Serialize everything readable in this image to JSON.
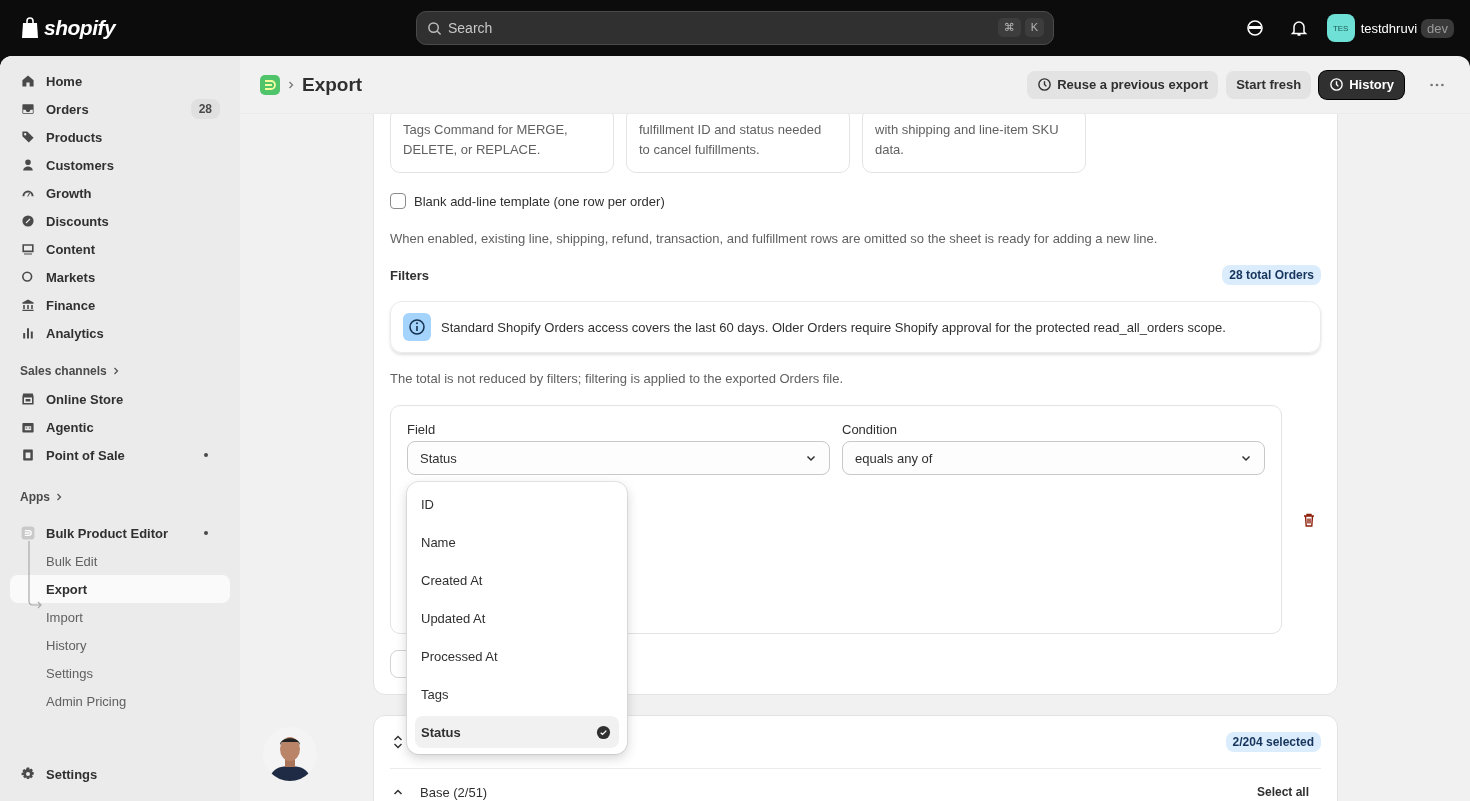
{
  "topbar": {
    "logo": "shopify",
    "search": {
      "placeholder": "Search",
      "keys": [
        "⌘",
        "K"
      ]
    },
    "user": {
      "initials": "TES",
      "name": "testdhruvi",
      "badge": "dev"
    }
  },
  "sidebar": {
    "items": [
      {
        "label": "Home"
      },
      {
        "label": "Orders",
        "count": "28"
      },
      {
        "label": "Products"
      },
      {
        "label": "Customers"
      },
      {
        "label": "Growth"
      },
      {
        "label": "Discounts"
      },
      {
        "label": "Content"
      },
      {
        "label": "Markets"
      },
      {
        "label": "Finance"
      },
      {
        "label": "Analytics"
      }
    ],
    "sales_channels": {
      "heading": "Sales channels",
      "items": [
        {
          "label": "Online Store",
          "dot": false
        },
        {
          "label": "Agentic",
          "dot": false
        },
        {
          "label": "Point of Sale",
          "dot": true
        }
      ]
    },
    "apps": {
      "heading": "Apps",
      "app": {
        "label": "Bulk Product Editor",
        "dot": true
      },
      "children": [
        {
          "label": "Bulk Edit",
          "selected": false
        },
        {
          "label": "Export",
          "selected": true
        },
        {
          "label": "Import",
          "selected": false
        },
        {
          "label": "History",
          "selected": false
        },
        {
          "label": "Settings",
          "selected": false
        },
        {
          "label": "Admin Pricing",
          "selected": false
        }
      ]
    },
    "footer": "Settings"
  },
  "header": {
    "title": "Export",
    "buttons": [
      {
        "label": "Reuse a previous export",
        "clock": true,
        "kind": "secondary"
      },
      {
        "label": "Start fresh",
        "clock": false,
        "kind": "secondary"
      },
      {
        "label": "History",
        "clock": true,
        "kind": "primary"
      }
    ]
  },
  "templates": [
    {
      "lines": [
        "Tags Command for MERGE,",
        "DELETE, or REPLACE."
      ]
    },
    {
      "lines": [
        "fulfillment ID and status needed",
        "to cancel fulfillments."
      ]
    },
    {
      "lines": [
        "with shipping and line-item SKU",
        "data."
      ]
    }
  ],
  "blank_template": {
    "label": "Blank add-line template (one row per order)",
    "checked": false
  },
  "hint": "When enabled, existing line, shipping, refund, transaction, and fulfillment rows are omitted so the sheet is ready for adding a new line.",
  "filters": {
    "title": "Filters",
    "badge": "28 total Orders",
    "info": "Standard Shopify Orders access covers the last 60 days. Older Orders require Shopify approval for the protected read_all_orders scope.",
    "note": "The total is not reduced by filters; filtering is applied to the exported Orders file.",
    "rule": {
      "field": {
        "label": "Field",
        "value": "Status"
      },
      "condition": {
        "label": "Condition",
        "value": "equals any of"
      }
    },
    "add_button": {
      "kind": "partly_hidden"
    },
    "dropdown": [
      {
        "label": "ID",
        "selected": false
      },
      {
        "label": "Name",
        "selected": false
      },
      {
        "label": "Created At",
        "selected": false
      },
      {
        "label": "Updated At",
        "selected": false
      },
      {
        "label": "Processed At",
        "selected": false
      },
      {
        "label": "Tags",
        "selected": false
      },
      {
        "label": "Status",
        "selected": true
      }
    ]
  },
  "columns": {
    "badge": "2/204 selected",
    "groups": [
      {
        "label": "Base (2/51)",
        "expanded": true,
        "action": "Select all"
      }
    ]
  }
}
